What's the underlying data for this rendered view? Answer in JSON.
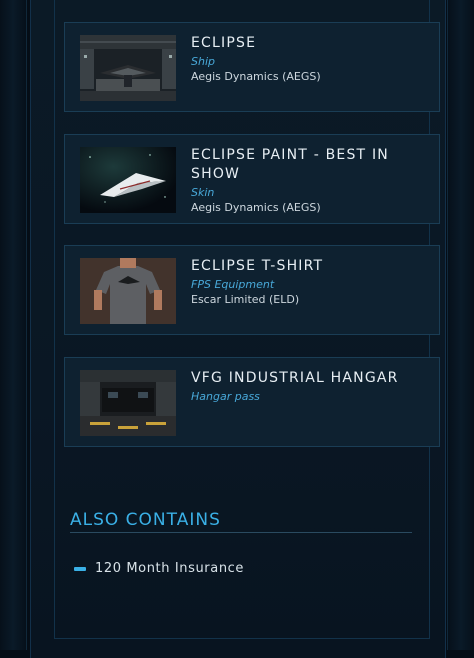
{
  "items": [
    {
      "name": "ECLIPSE",
      "type": "Ship",
      "maker": "Aegis Dynamics (AEGS)",
      "thumb_icon": "hangar-ship-image"
    },
    {
      "name": "ECLIPSE PAINT - BEST IN SHOW",
      "type": "Skin",
      "maker": "Aegis Dynamics (AEGS)",
      "thumb_icon": "white-ship-space-image"
    },
    {
      "name": "ECLIPSE T-SHIRT",
      "type": "FPS Equipment",
      "maker": "Escar Limited (ELD)",
      "thumb_icon": "tshirt-image"
    },
    {
      "name": "VFG INDUSTRIAL HANGAR",
      "type": "Hangar pass",
      "maker": "",
      "thumb_icon": "hangar-interior-image"
    }
  ],
  "also_contains": {
    "title": "ALSO CONTAINS",
    "items": [
      "120 Month Insurance"
    ]
  },
  "colors": {
    "accent": "#3ab0e6",
    "card_bg": "#0e2130",
    "card_border": "#1a3d55"
  }
}
